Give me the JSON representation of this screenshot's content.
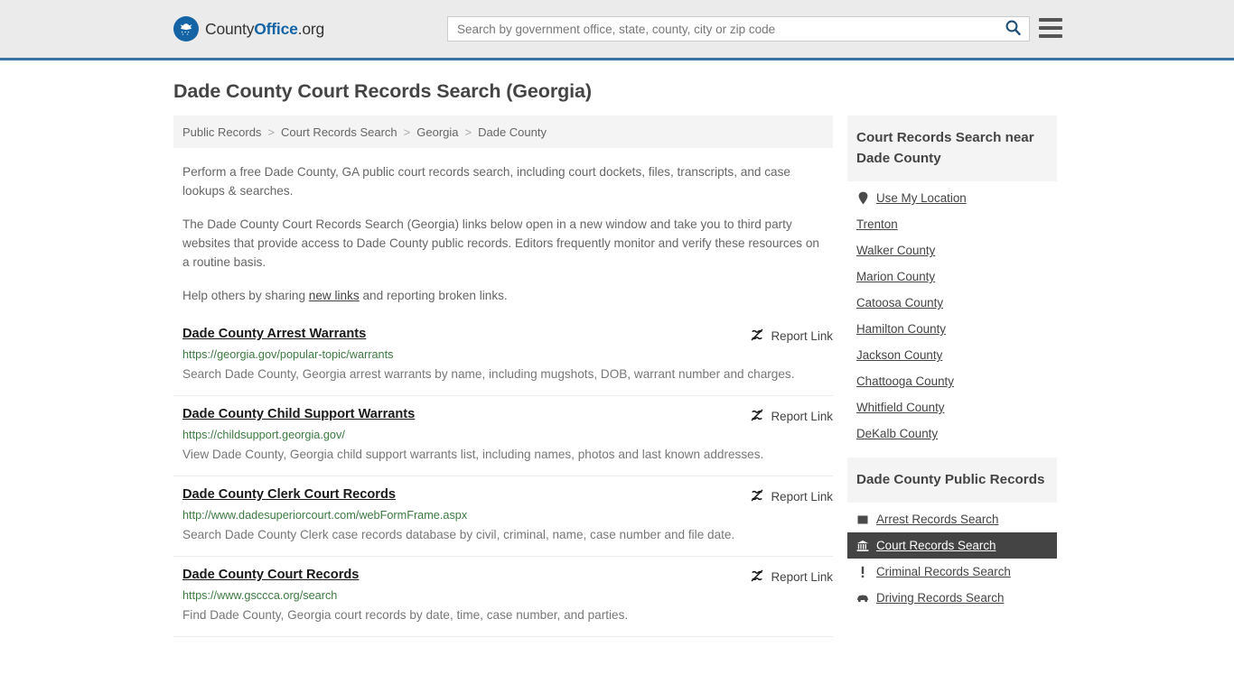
{
  "header": {
    "logo": {
      "part1": "County",
      "part2": "Office",
      "part3": ".org",
      "icon": "eagle-seal-icon"
    },
    "search": {
      "placeholder": "Search by government office, state, county, city or zip code",
      "value": "",
      "icon": "search-icon"
    },
    "menu_icon": "hamburger-menu-icon",
    "accent_color": "#3a72a4",
    "background_color": "#ebebeb"
  },
  "page": {
    "title": "Dade County Court Records Search (Georgia)"
  },
  "breadcrumb": {
    "separator": ">",
    "items": [
      {
        "label": "Public Records"
      },
      {
        "label": "Court Records Search"
      },
      {
        "label": "Georgia"
      },
      {
        "label": "Dade County"
      }
    ]
  },
  "intro": {
    "p1": "Perform a free Dade County, GA public court records search, including court dockets, files, transcripts, and case lookups & searches.",
    "p2": "The Dade County Court Records Search (Georgia) links below open in a new window and take you to third party websites that provide access to Dade County public records. Editors frequently monitor and verify these resources on a routine basis.",
    "p3_before": "Help others by sharing ",
    "p3_link": "new links",
    "p3_after": " and reporting broken links."
  },
  "links": {
    "report_label": "Report Link",
    "report_icon": "broken-link-icon",
    "items": [
      {
        "title": "Dade County Arrest Warrants",
        "url": "https://georgia.gov/popular-topic/warrants",
        "description": "Search Dade County, Georgia arrest warrants by name, including mugshots, DOB, warrant number and charges."
      },
      {
        "title": "Dade County Child Support Warrants",
        "url": "https://childsupport.georgia.gov/",
        "description": "View Dade County, Georgia child support warrants list, including names, photos and last known addresses."
      },
      {
        "title": "Dade County Clerk Court Records",
        "url": "http://www.dadesuperiorcourt.com/webFormFrame.aspx",
        "description": "Search Dade County Clerk case records database by civil, criminal, name, case number and file date."
      },
      {
        "title": "Dade County Court Records",
        "url": "https://www.gsccca.org/search",
        "description": "Find Dade County, Georgia court records by date, time, case number, and parties."
      }
    ]
  },
  "sidebar": {
    "nearby": {
      "heading": "Court Records Search near Dade County",
      "items": [
        {
          "label": "Use My Location",
          "icon": "map-pin-icon"
        },
        {
          "label": "Trenton",
          "icon": ""
        },
        {
          "label": "Walker County",
          "icon": ""
        },
        {
          "label": "Marion County",
          "icon": ""
        },
        {
          "label": "Catoosa County",
          "icon": ""
        },
        {
          "label": "Hamilton County",
          "icon": ""
        },
        {
          "label": "Jackson County",
          "icon": ""
        },
        {
          "label": "Chattooga County",
          "icon": ""
        },
        {
          "label": "Whitfield County",
          "icon": ""
        },
        {
          "label": "DeKalb County",
          "icon": ""
        }
      ]
    },
    "public_records": {
      "heading": "Dade County Public Records",
      "items": [
        {
          "label": "Arrest Records Search",
          "icon": "fingerprint-card-icon",
          "active": false
        },
        {
          "label": "Court Records Search",
          "icon": "courthouse-icon",
          "active": true
        },
        {
          "label": "Criminal Records Search",
          "icon": "exclamation-icon",
          "active": false
        },
        {
          "label": "Driving Records Search",
          "icon": "car-icon",
          "active": false
        }
      ]
    },
    "active_bg": "#444444"
  }
}
